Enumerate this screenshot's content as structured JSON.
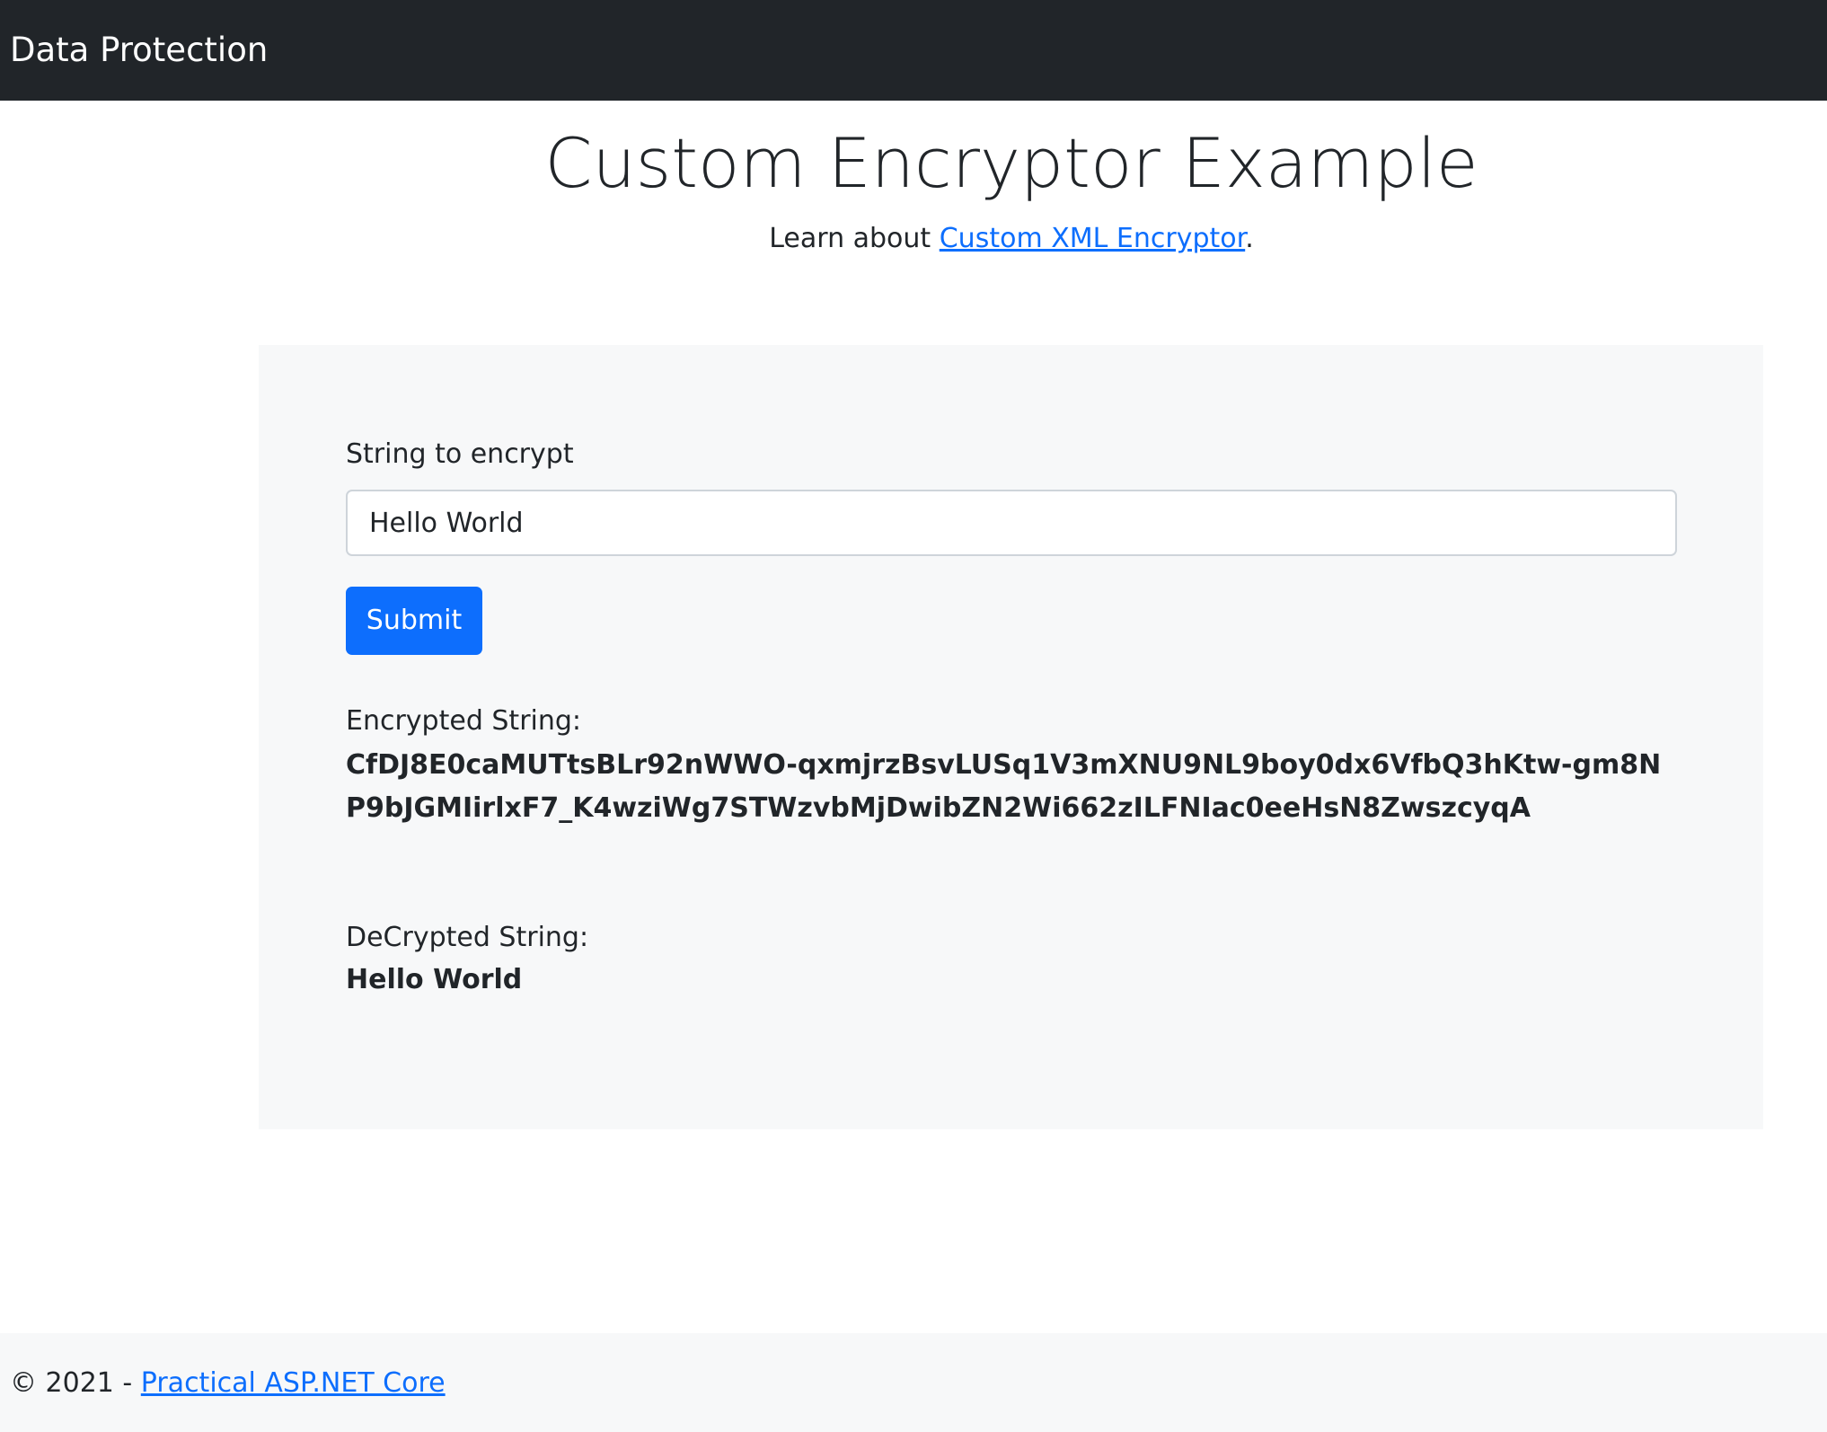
{
  "navbar": {
    "brand": "Data Protection"
  },
  "main": {
    "title": "Custom Encryptor Example",
    "lead_prefix": "Learn about ",
    "lead_link": "Custom XML Encryptor",
    "lead_suffix": "."
  },
  "form": {
    "input_label": "String to encrypt",
    "input_value": "Hello World",
    "submit_label": "Submit"
  },
  "results": {
    "encrypted_label": "Encrypted String:",
    "encrypted_value": "CfDJ8E0caMUTtsBLr92nWWO-qxmjrzBsvLUSq1V3mXNU9NL9boy0dx6VfbQ3hKtw-gm8NP9bJGMIirlxF7_K4wziWg7STWzvbMjDwibZN2Wi662zILFNIac0eeHsN8ZwszcyqA",
    "decrypted_label": "DeCrypted String:",
    "decrypted_value": "Hello World"
  },
  "footer": {
    "copyright": "© 2021 - ",
    "link": "Practical ASP.NET Core"
  }
}
